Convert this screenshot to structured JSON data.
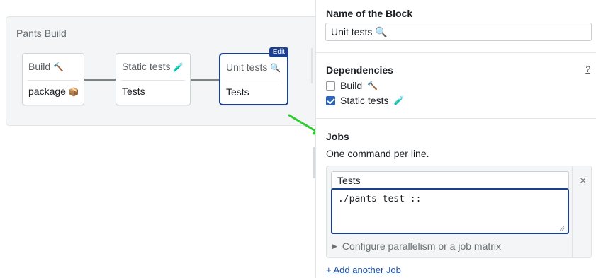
{
  "pipeline": {
    "title": "Pants Build",
    "blocks": [
      {
        "name": "Build",
        "icon": "hammer-icon",
        "icon_glyph": "🔨",
        "job": "package",
        "job_icon": "package-icon",
        "job_glyph": "📦"
      },
      {
        "name": "Static tests",
        "icon": "test-tube-icon",
        "icon_glyph": "🧪",
        "job": "Tests"
      },
      {
        "name": "Unit tests",
        "icon": "magnifier-icon",
        "icon_glyph": "🔍",
        "job": "Tests",
        "badge": "Edit",
        "selected": true
      }
    ]
  },
  "panel": {
    "name_label": "Name of the Block",
    "name_value": "Unit tests 🔍",
    "dependencies_label": "Dependencies",
    "dependencies_help": "?",
    "dependencies": [
      {
        "label": "Build",
        "glyph": "🔨",
        "checked": false
      },
      {
        "label": "Static tests",
        "glyph": "🧪",
        "checked": true
      }
    ],
    "jobs_label": "Jobs",
    "jobs_hint": "One command per line.",
    "job_name": "Tests",
    "job_commands": "./pants test ::",
    "remove_job": "×",
    "parallelism_label": "Configure parallelism or a job matrix",
    "add_job_link": "+ Add another Job"
  },
  "colors": {
    "accent": "#1d3f8f",
    "checkbox": "#2a63b8",
    "arrow": "#2ecc2e",
    "link": "#1d4ea8"
  }
}
